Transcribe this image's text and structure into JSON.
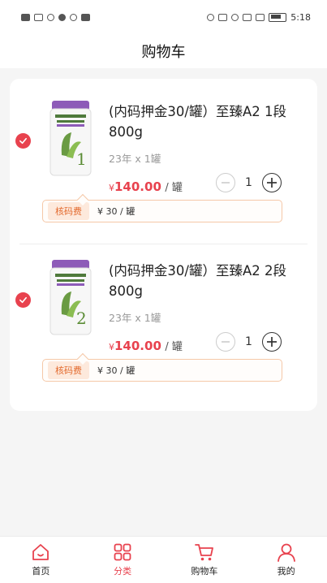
{
  "status_bar": {
    "time": "5:18",
    "left_icons": [
      "hd-icon",
      "signal-icon",
      "wifi-icon",
      "chat-icon",
      "target-icon",
      "mail-icon"
    ],
    "right_icons": [
      "eye-icon",
      "nfc-icon",
      "alarm-icon",
      "bluetooth-icon",
      "vibrate-icon",
      "battery-icon"
    ]
  },
  "header": {
    "title": "购物车"
  },
  "items": [
    {
      "title": "(内码押金30/罐）至臻A2 1段 800g",
      "spec": "23年 x 1罐",
      "currency": "¥",
      "price": "140.00",
      "price_unit": "/ 罐",
      "quantity": "1",
      "selected": true,
      "fee_label": "核码费",
      "fee_text": "¥ 30 / 罐",
      "stage": "1"
    },
    {
      "title": "(内码押金30/罐）至臻A2 2段 800g",
      "spec": "23年 x 1罐",
      "currency": "¥",
      "price": "140.00",
      "price_unit": "/ 罐",
      "quantity": "1",
      "selected": true,
      "fee_label": "核码费",
      "fee_text": "¥ 30 / 罐",
      "stage": "2"
    }
  ],
  "tabbar": {
    "tabs": [
      {
        "label": "首页",
        "icon": "home-icon",
        "active": false
      },
      {
        "label": "分类",
        "icon": "grid-icon",
        "active": true
      },
      {
        "label": "购物车",
        "icon": "cart-icon",
        "active": false
      },
      {
        "label": "我的",
        "icon": "user-icon",
        "active": false
      }
    ]
  },
  "colors": {
    "accent": "#e8424e",
    "fee_tag": "#e36a2e",
    "background": "#f5f5f5"
  }
}
